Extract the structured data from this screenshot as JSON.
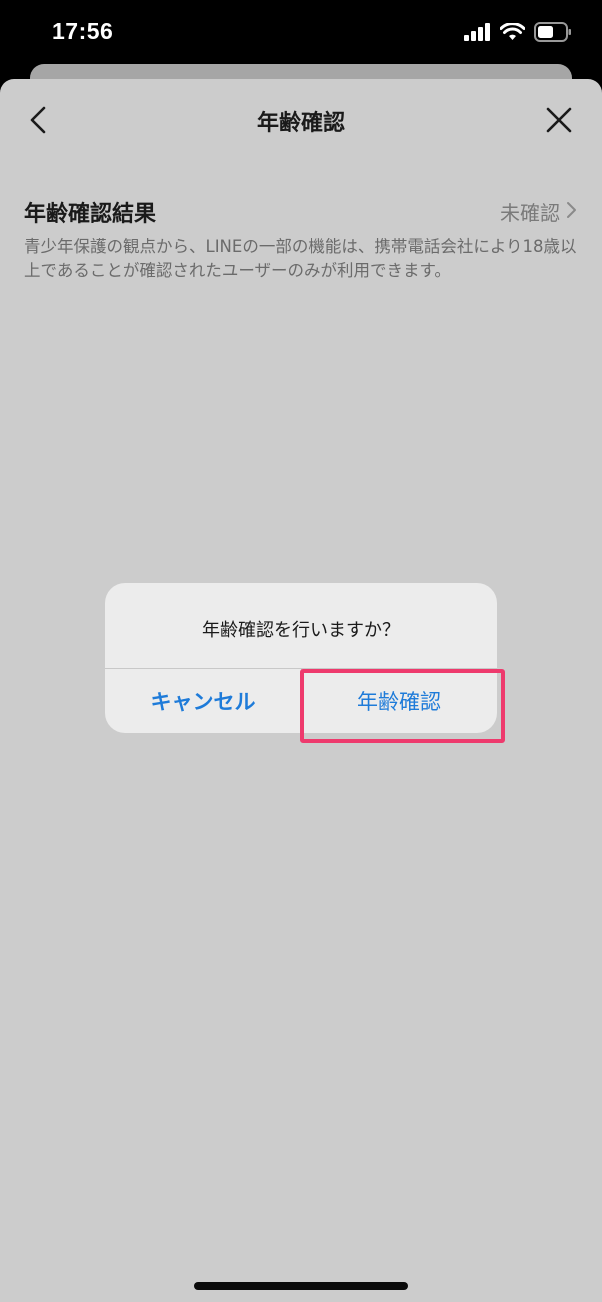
{
  "status_bar": {
    "time": "17:56",
    "icons": [
      "signal-icon",
      "wifi-icon",
      "battery-icon"
    ]
  },
  "nav": {
    "title": "年齢確認",
    "back_icon": "chevron-left-icon",
    "close_icon": "close-icon"
  },
  "section": {
    "heading": "年齢確認結果",
    "status": "未確認",
    "description": "青少年保護の観点から、LINEの一部の機能は、携帯電話会社により18歳以上であることが確認されたユーザーのみが利用できます。"
  },
  "dialog": {
    "message": "年齢確認を行いますか？",
    "cancel_label": "キャンセル",
    "confirm_label": "年齢確認"
  },
  "colors": {
    "accent": "#1e7bd9",
    "highlight": "#ee3a6d",
    "overlay": "#cccccc"
  }
}
